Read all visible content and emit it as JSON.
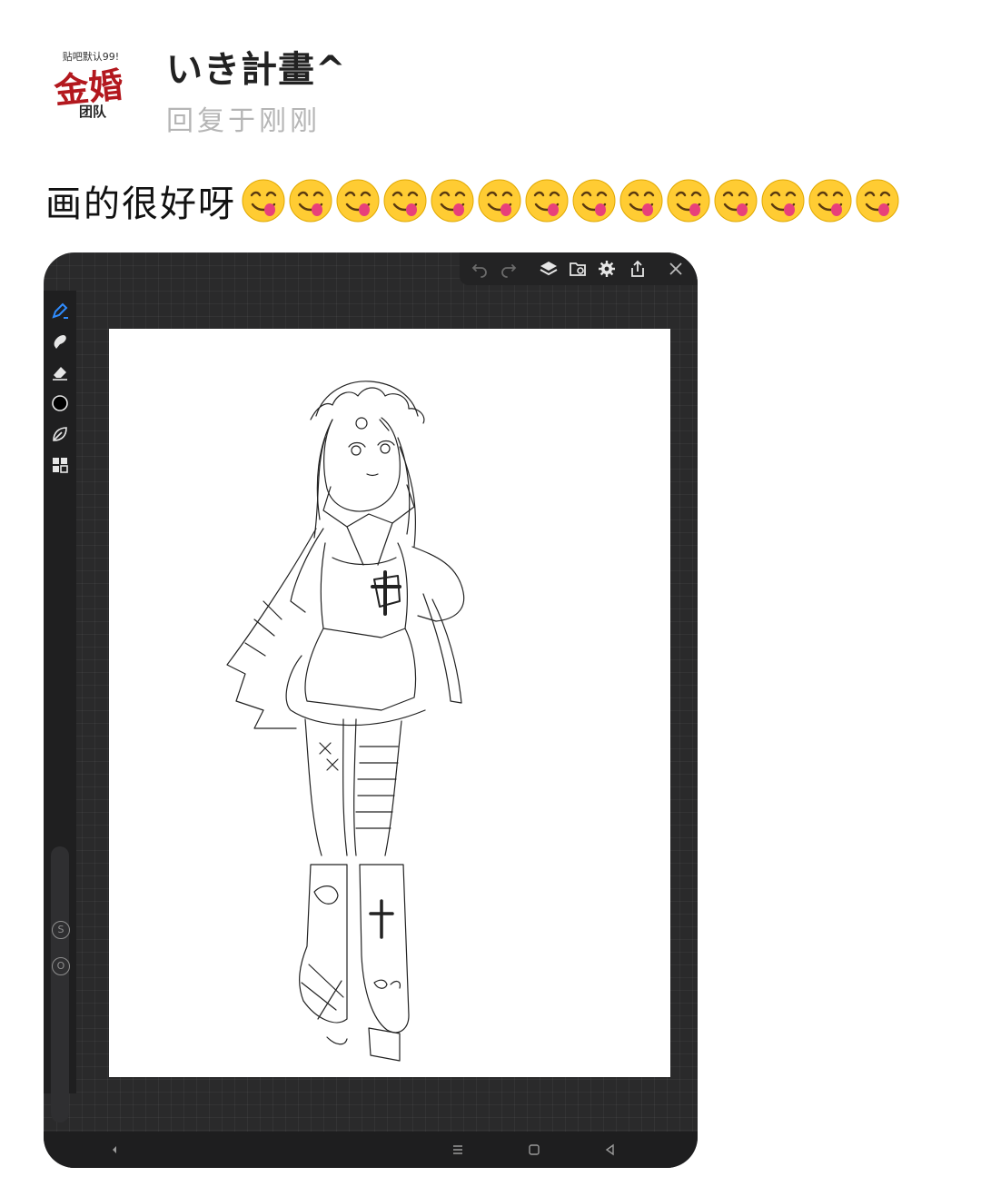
{
  "post": {
    "username": "いき計畫^",
    "meta": "回复于刚刚",
    "comment_text": "画的很好呀",
    "emoji_icon": "face-savoring-food-icon",
    "emoji_count": 14
  },
  "avatar": {
    "top_text": "贴吧默认99!",
    "big_text": "金婚",
    "small_text": "团队"
  },
  "app": {
    "toolbar_top": [
      "undo-icon",
      "redo-icon",
      "layers-icon",
      "import-icon",
      "settings-icon",
      "share-icon",
      "close-icon"
    ],
    "tools": [
      "pen-icon",
      "smudge-icon",
      "eraser-icon",
      "color-swatch-icon",
      "leaf-icon",
      "grid-icon"
    ],
    "size_button": "S",
    "opacity_button": "O",
    "active_color": "#000000",
    "accent_color": "#2f8cff"
  },
  "nav": [
    "back-icon",
    "menu-icon",
    "home-icon",
    "recent-icon"
  ]
}
